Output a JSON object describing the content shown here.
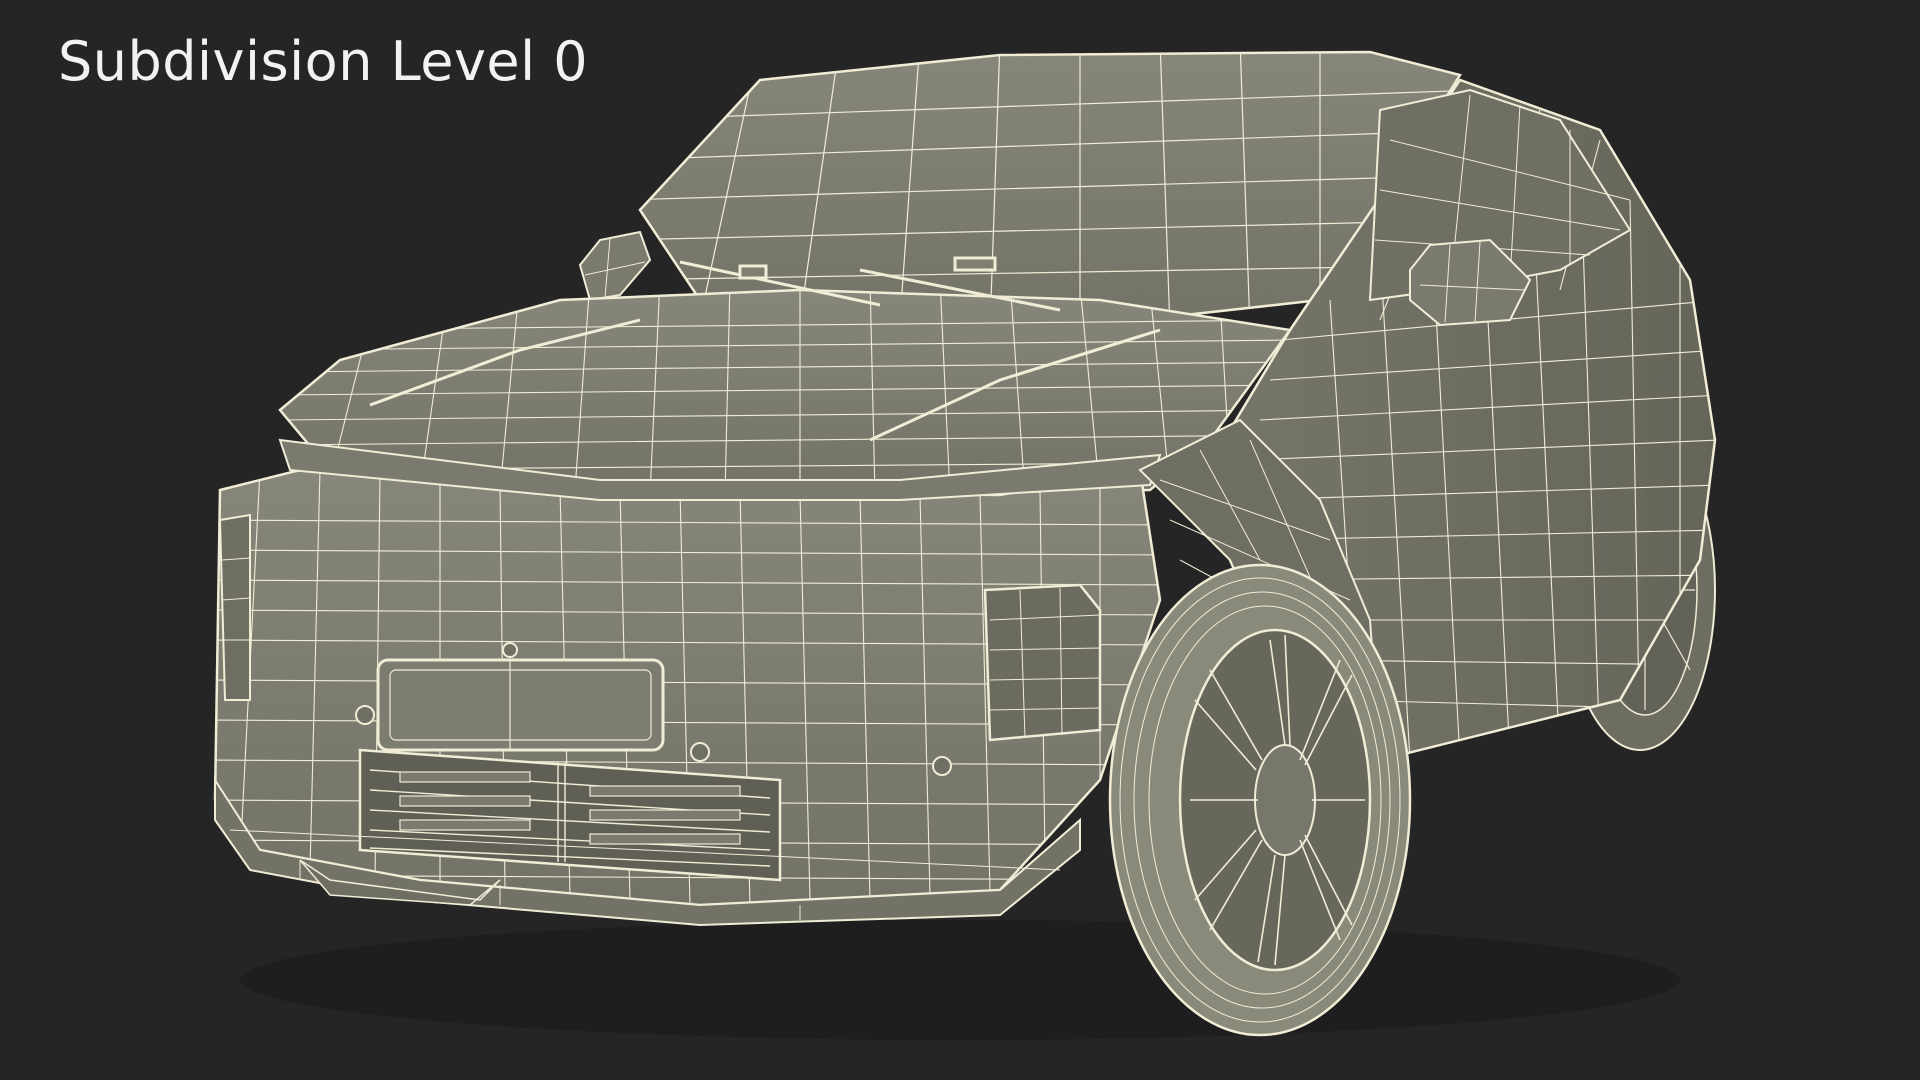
{
  "caption": "Subdivision Level 0",
  "colors": {
    "background": "#252525",
    "body_fill": "#7f7f71",
    "body_shade": "#6b6b5f",
    "wire": "#f0ecd6",
    "tyre": "#8a8a7b"
  },
  "subject": {
    "icon": "wireframe-suv-render"
  }
}
